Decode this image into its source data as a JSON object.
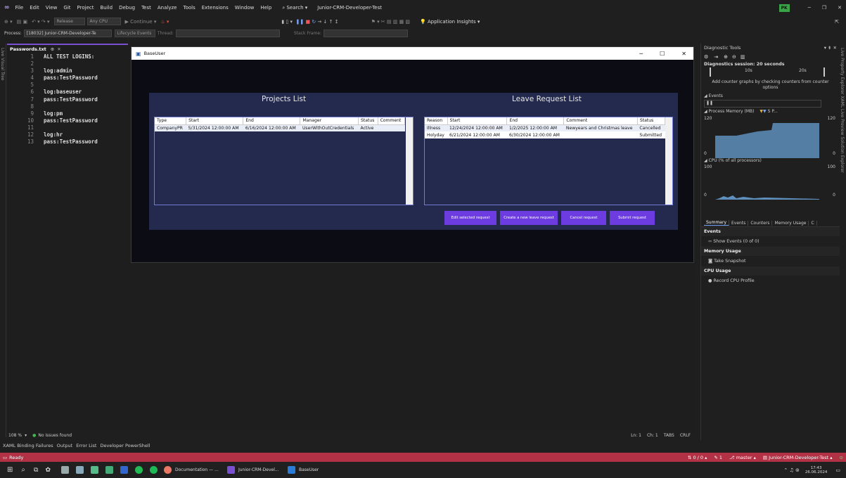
{
  "ide": {
    "menu": [
      "File",
      "Edit",
      "View",
      "Git",
      "Project",
      "Build",
      "Debug",
      "Test",
      "Analyze",
      "Tools",
      "Extensions",
      "Window",
      "Help"
    ],
    "search_label": "Search",
    "solution_name": "Junior-CRM-Developer-Test",
    "profile_initials": "PK",
    "toolbar": {
      "config": "Release",
      "platform": "Any CPU",
      "continue_label": "Continue",
      "app_insights": "Application Insights"
    },
    "procbar": {
      "process_label": "Process:",
      "process_value": "[18032] Junior-CRM-Developer-Te",
      "lifecycle_label": "Lifecycle Events",
      "thread_label": "Thread:",
      "stack_frame_label": "Stack Frame:"
    },
    "left_strip_label": "Live Visual Tree",
    "right_strip_label": "Live Property Explorer  XAML Live Preview  Solution Explorer"
  },
  "editor": {
    "tab": "Passwords.txt",
    "lines": [
      {
        "n": "1",
        "t": "ALL TEST LOGINS:"
      },
      {
        "n": "2",
        "t": ""
      },
      {
        "n": "3",
        "t": "log:admin"
      },
      {
        "n": "4",
        "t": "pass:TestPassword"
      },
      {
        "n": "5",
        "t": ""
      },
      {
        "n": "6",
        "t": "log:baseuser"
      },
      {
        "n": "7",
        "t": "pass:TestPassword"
      },
      {
        "n": "8",
        "t": ""
      },
      {
        "n": "9",
        "t": "log:pm"
      },
      {
        "n": "10",
        "t": "pass:TestPassword"
      },
      {
        "n": "11",
        "t": ""
      },
      {
        "n": "12",
        "t": "log:hr"
      },
      {
        "n": "13",
        "t": "pass:TestPassword"
      }
    ],
    "zoom": "108 %",
    "issues": "No issues found",
    "ln": "Ln: 1",
    "ch": "Ch: 1",
    "tabs": "TABS",
    "crlf": "CRLF"
  },
  "output_tabs": [
    "XAML Binding Failures",
    "Output",
    "Error List",
    "Developer PowerShell"
  ],
  "status": {
    "ready": "Ready",
    "errors": "0 / 0",
    "pencil": "1",
    "branch": "master",
    "solution": "Junior-CRM-Developer-Test"
  },
  "diagnostics": {
    "title": "Diagnostic Tools",
    "session": "Diagnostics session: 20 seconds",
    "t10": "10s",
    "t20": "20s",
    "hint": "Add counter graphs by checking counters from counter options",
    "events": "Events",
    "memory_title": "Process Memory (MB)",
    "mem_legend": "S    P...",
    "mem_max": "120",
    "mem_min": "0",
    "cpu_title": "CPU (% of all processors)",
    "cpu_max": "100",
    "cpu_min": "0",
    "tabs": [
      "Summary",
      "Events",
      "Counters",
      "Memory Usage",
      "C"
    ],
    "sec_events": "Events",
    "show_events": "Show Events (0 of 0)",
    "sec_memory": "Memory Usage",
    "take_snapshot": "Take Snapshot",
    "sec_cpu": "CPU Usage",
    "record_cpu": "Record CPU Profile"
  },
  "app": {
    "title": "BaseUser",
    "projects_title": "Projects List",
    "projects_cols": [
      "Type",
      "Start",
      "End",
      "Manager",
      "Status",
      "Comment"
    ],
    "projects_rows": [
      [
        "CompanyPR",
        "5/31/2024 12:00:00 AM",
        "6/16/2024 12:00:00 AM",
        "UserWithOutCredentials",
        "Active",
        ""
      ]
    ],
    "leave_title": "Leave Request List",
    "leave_cols": [
      "Reason",
      "Start",
      "End",
      "Comment",
      "Status"
    ],
    "leave_rows": [
      [
        "Illness",
        "12/24/2024 12:00:00 AM",
        "1/2/2025 12:00:00 AM",
        "Newyears and Christmas leave",
        "Cancelled"
      ],
      [
        "Holyday",
        "6/21/2024 12:00:00 AM",
        "6/30/2024 12:00:00 AM",
        "",
        "Submitted"
      ]
    ],
    "buttons": {
      "edit": "Edit selected request",
      "create": "Create a new leave request",
      "cancel": "Cancel request",
      "submit": "Submit request"
    }
  },
  "taskbar": {
    "documentation": "Documentation — ...",
    "vs": "Junior-CRM-Devel...",
    "baseuser": "BaseUser",
    "time": "17:43",
    "date": "26.06.2024"
  }
}
